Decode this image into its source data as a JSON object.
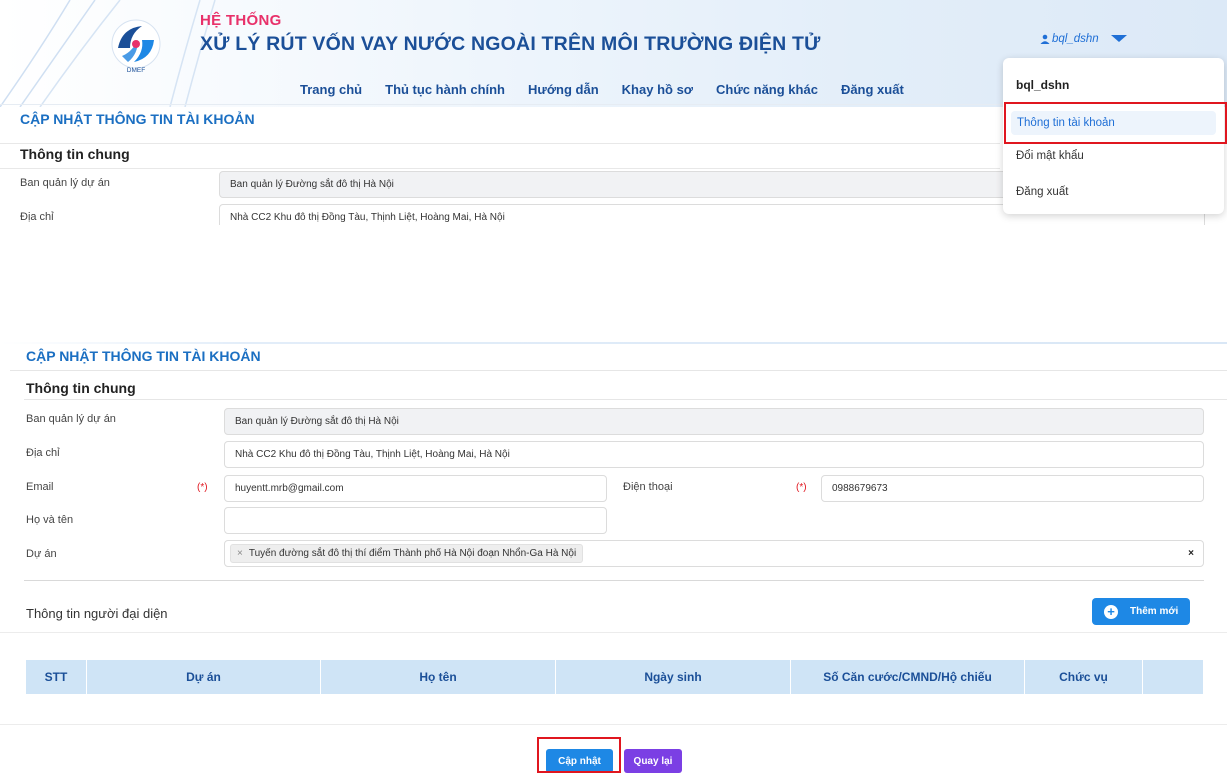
{
  "header": {
    "system_label": "HỆ THỐNG",
    "system_name": "XỬ LÝ RÚT VỐN VAY NƯỚC NGOÀI TRÊN MÔI TRƯỜNG ĐIỆN TỬ",
    "logo_text": "DMEF",
    "nav": [
      "Trang chủ",
      "Thủ tục hành chính",
      "Hướng dẫn",
      "Khay hồ sơ",
      "Chức năng khác",
      "Đăng xuất"
    ],
    "user": "bql_dshn"
  },
  "user_menu": {
    "name": "bql_dshn",
    "items": [
      "Thông tin tài khoản",
      "Đổi mật khẩu",
      "Đăng xuất"
    ]
  },
  "form_top": {
    "title": "CẬP NHẬT THÔNG TIN TÀI KHOẢN",
    "subtitle": "Thông tin chung",
    "ban_label": "Ban quản lý dự án",
    "ban_value": "Ban quản lý Đường sắt đô thị Hà Nội",
    "address_label": "Địa chỉ",
    "address_value": "Nhà CC2 Khu đô thị Đồng Tàu, Thịnh Liệt, Hoàng Mai, Hà Nội"
  },
  "form": {
    "title": "CẬP NHẬT THÔNG TIN TÀI KHOẢN",
    "subtitle": "Thông tin chung",
    "required_mark": "(*)",
    "ban_label": "Ban quản lý dự án",
    "ban_value": "Ban quản lý Đường sắt đô thị Hà Nội",
    "address_label": "Địa chỉ",
    "address_value": "Nhà CC2 Khu đô thị Đồng Tàu, Thịnh Liệt, Hoàng Mai, Hà Nội",
    "email_label": "Email",
    "email_value": "huyentt.mrb@gmail.com",
    "phone_label": "Điện thoại",
    "phone_value": "0988679673",
    "name_label": "Họ và tên",
    "name_value": "",
    "project_label": "Dự án",
    "project_tag": "Tuyến đường sắt đô thị thí điểm Thành phố Hà Nội đoạn Nhổn-Ga Hà Nội",
    "tag_remove": "×",
    "clear": "×"
  },
  "representatives": {
    "title": "Thông tin người đại diện",
    "add_label": "Thêm mới",
    "columns": [
      "STT",
      "Dự án",
      "Họ tên",
      "Ngày sinh",
      "Số Căn cước/CMND/Hộ chiếu",
      "Chức vụ",
      ""
    ]
  },
  "actions": {
    "update": "Cập nhật",
    "back": "Quay lại"
  },
  "colors": {
    "primary": "#1e88e5",
    "title_blue": "#1b4f98",
    "accent_pink": "#e8316a",
    "back_button": "#7b3fe4",
    "highlight": "#e0161f"
  }
}
